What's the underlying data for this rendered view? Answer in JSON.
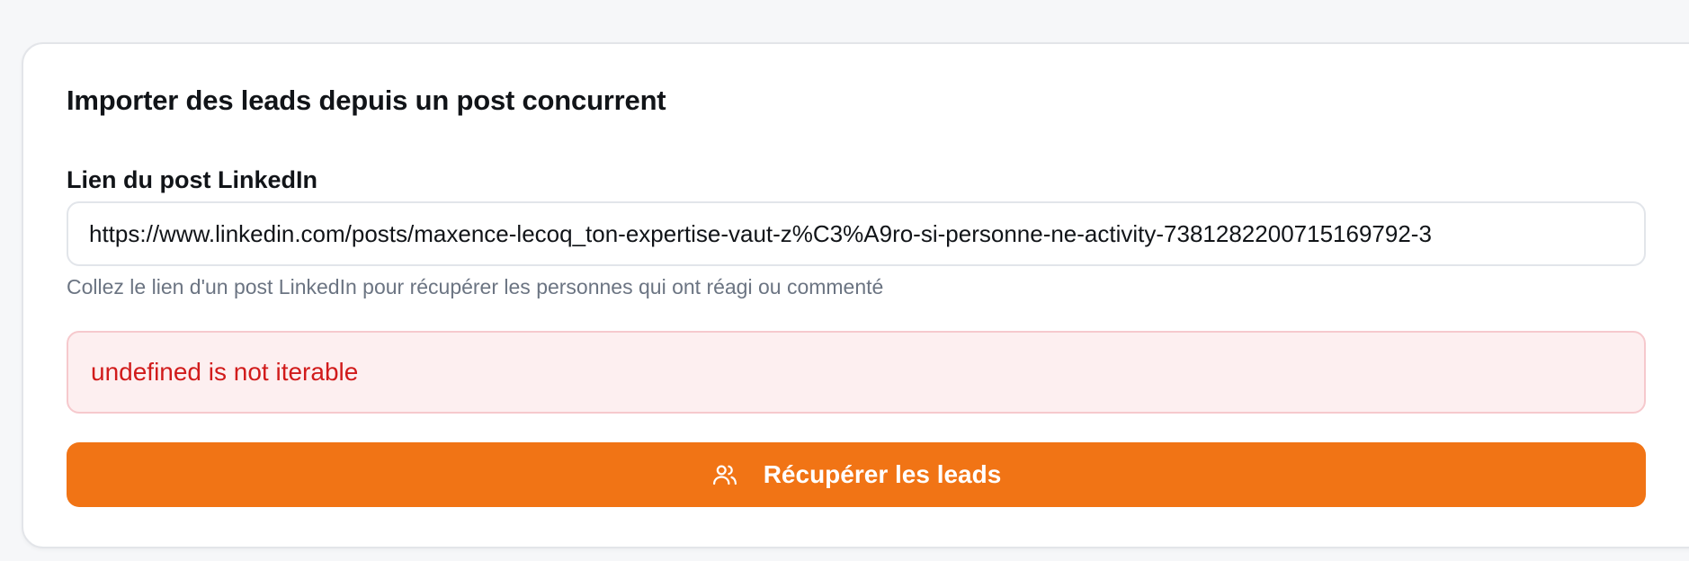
{
  "form": {
    "title": "Importer des leads depuis un post concurrent",
    "field_label": "Lien du post LinkedIn",
    "url_value": "https://www.linkedin.com/posts/maxence-lecoq_ton-expertise-vaut-z%C3%A9ro-si-personne-ne-activity-7381282200715169792-3",
    "help_text": "Collez le lien d'un post LinkedIn pour récupérer les personnes qui ont réagi ou commenté",
    "error_message": "undefined is not iterable",
    "submit_label": "Récupérer les leads",
    "submit_icon": "users-icon"
  },
  "colors": {
    "accent": "#f17415",
    "error_text": "#d11b1b",
    "error_bg": "#fdeff0"
  }
}
